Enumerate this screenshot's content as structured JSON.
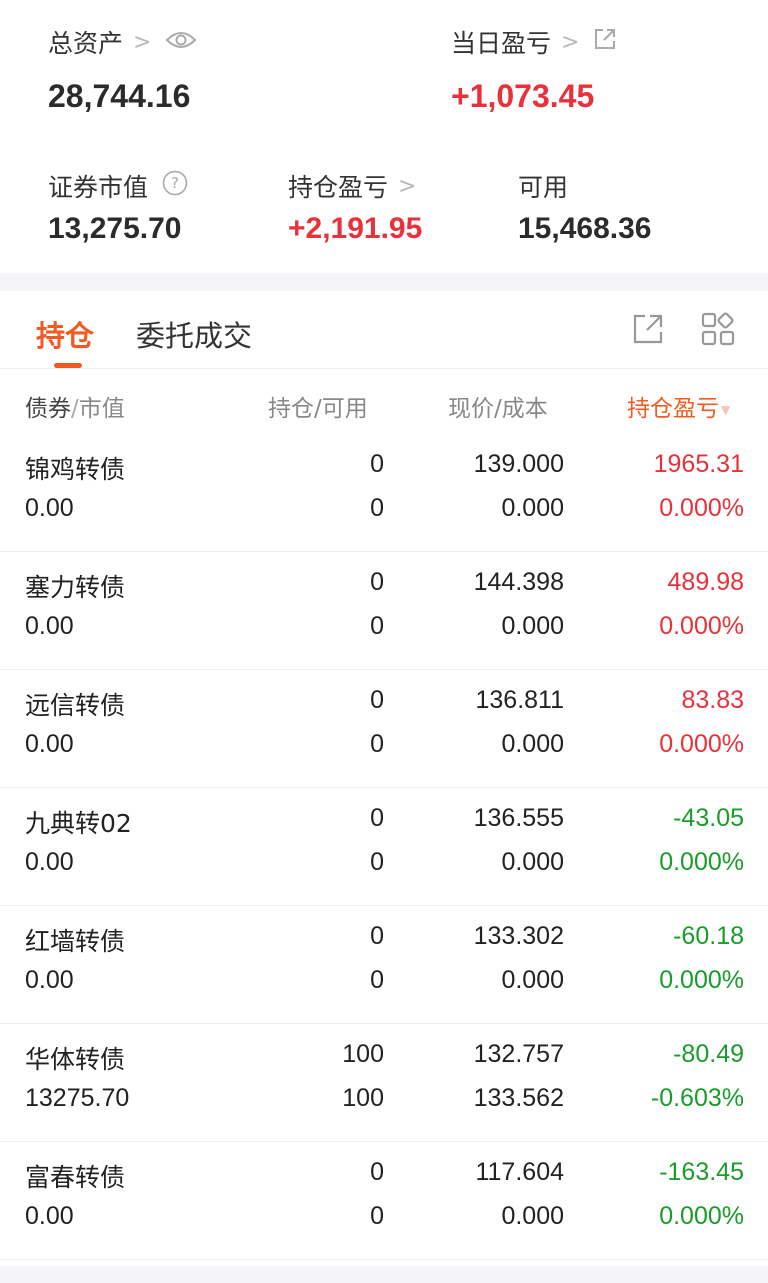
{
  "summary": {
    "total_assets_label": "总资产",
    "total_assets_value": "28,744.16",
    "daily_pl_label": "当日盈亏",
    "daily_pl_value": "+1,073.45",
    "market_value_label": "证券市值",
    "market_value_value": "13,275.70",
    "position_pl_label": "持仓盈亏",
    "position_pl_value": "+2,191.95",
    "available_label": "可用",
    "available_value": "15,468.36"
  },
  "tabs": [
    {
      "label": "持仓",
      "active": true
    },
    {
      "label": "委托成交",
      "active": false
    }
  ],
  "columns": {
    "col1_a": "债券",
    "col1_sep": "/",
    "col1_b": "市值",
    "col2": "持仓/可用",
    "col3": "现价/成本",
    "col4": "持仓盈亏"
  },
  "colors": {
    "accent": "#f15a22",
    "up": "#e8313a",
    "down": "#1a9c2a"
  },
  "holdings": [
    {
      "name": "锦鸡转债",
      "market_value": "0.00",
      "position": "0",
      "available": "0",
      "price": "139.000",
      "cost": "0.000",
      "pl": "1965.31",
      "pl_pct": "0.000%",
      "trend": "up"
    },
    {
      "name": "塞力转债",
      "market_value": "0.00",
      "position": "0",
      "available": "0",
      "price": "144.398",
      "cost": "0.000",
      "pl": "489.98",
      "pl_pct": "0.000%",
      "trend": "up"
    },
    {
      "name": "远信转债",
      "market_value": "0.00",
      "position": "0",
      "available": "0",
      "price": "136.811",
      "cost": "0.000",
      "pl": "83.83",
      "pl_pct": "0.000%",
      "trend": "up"
    },
    {
      "name": "九典转02",
      "market_value": "0.00",
      "position": "0",
      "available": "0",
      "price": "136.555",
      "cost": "0.000",
      "pl": "-43.05",
      "pl_pct": "0.000%",
      "trend": "down"
    },
    {
      "name": "红墙转债",
      "market_value": "0.00",
      "position": "0",
      "available": "0",
      "price": "133.302",
      "cost": "0.000",
      "pl": "-60.18",
      "pl_pct": "0.000%",
      "trend": "down"
    },
    {
      "name": "华体转债",
      "market_value": "13275.70",
      "position": "100",
      "available": "100",
      "price": "132.757",
      "cost": "133.562",
      "pl": "-80.49",
      "pl_pct": "-0.603%",
      "trend": "down"
    },
    {
      "name": "富春转债",
      "market_value": "0.00",
      "position": "0",
      "available": "0",
      "price": "117.604",
      "cost": "0.000",
      "pl": "-163.45",
      "pl_pct": "0.000%",
      "trend": "down"
    }
  ]
}
